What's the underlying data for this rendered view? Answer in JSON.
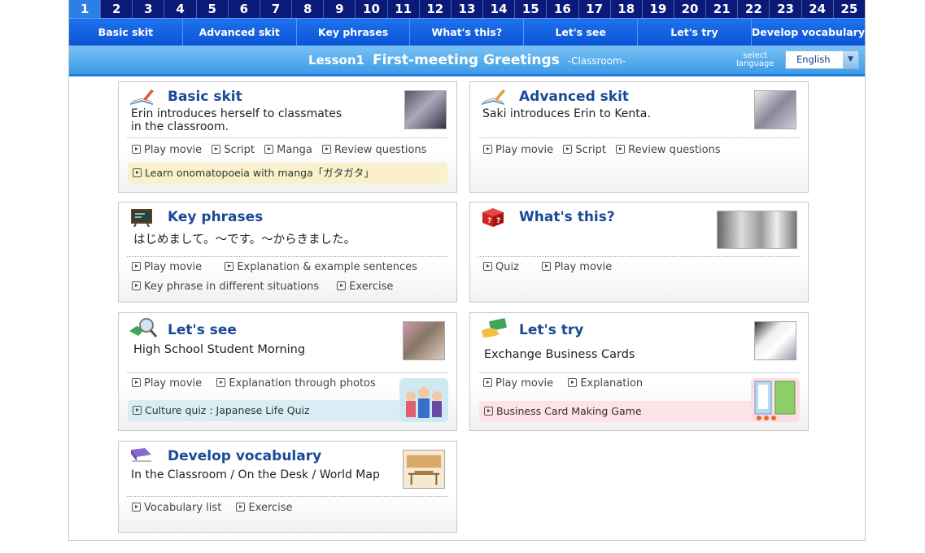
{
  "lesson_numbers": [
    "1",
    "2",
    "3",
    "4",
    "5",
    "6",
    "7",
    "8",
    "9",
    "10",
    "11",
    "12",
    "13",
    "14",
    "15",
    "16",
    "17",
    "18",
    "19",
    "20",
    "21",
    "22",
    "23",
    "24",
    "25"
  ],
  "sections": [
    "Basic skit",
    "Advanced skit",
    "Key phrases",
    "What's this?",
    "Let's see",
    "Let's try",
    "Develop vocabulary"
  ],
  "title": {
    "lesson": "Lesson1",
    "name": "First-meeting Greetings",
    "sub": "-Classroom-"
  },
  "language": {
    "label_line1": "select",
    "label_line2": "language",
    "selected": "English"
  },
  "cards": {
    "basic": {
      "title": "Basic skit",
      "desc1": "Erin introduces herself to classmates",
      "desc2": "in the classroom.",
      "links": [
        "Play movie",
        "Script",
        "Manga",
        "Review questions"
      ],
      "band": "Learn onomatopoeia with manga「ガタガタ」"
    },
    "advanced": {
      "title": "Advanced skit",
      "desc": "Saki introduces Erin to Kenta.",
      "links": [
        "Play movie",
        "Script",
        "Review questions"
      ]
    },
    "key": {
      "title": "Key phrases",
      "desc": "はじめまして。～です。～からきました。",
      "links1": [
        "Play movie",
        "Explanation & example sentences"
      ],
      "links2": [
        "Key phrase in different situations",
        "Exercise"
      ]
    },
    "whats": {
      "title": "What's this?",
      "links": [
        "Quiz",
        "Play movie"
      ]
    },
    "see": {
      "title": "Let's see",
      "desc": "High School Student Morning",
      "links": [
        "Play movie",
        "Explanation through photos"
      ],
      "band": "Culture quiz : Japanese Life Quiz"
    },
    "try": {
      "title": "Let's try",
      "desc": "Exchange Business Cards",
      "links": [
        "Play movie",
        "Explanation"
      ],
      "band": "Business Card Making Game"
    },
    "vocab": {
      "title": "Develop vocabulary",
      "desc": "In the Classroom / On the Desk / World Map",
      "links": [
        "Vocabulary list",
        "Exercise"
      ]
    }
  },
  "colors": {
    "nav_dark": "#0a1a78",
    "nav_blue": "#0b54d6",
    "title_blue": "#1a4a96"
  }
}
